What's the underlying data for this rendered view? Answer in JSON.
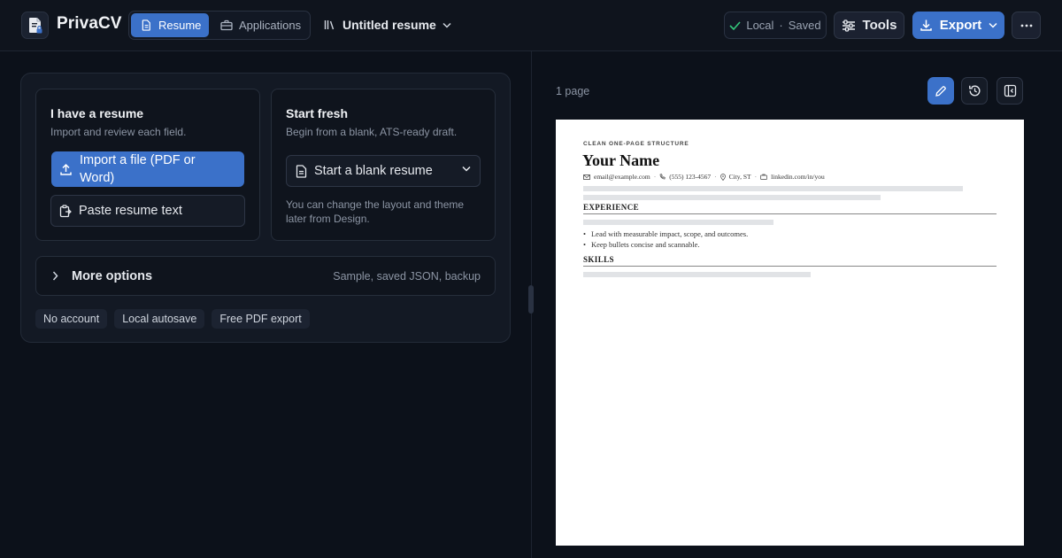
{
  "app": {
    "brand": "PrivaCV",
    "modes": [
      {
        "label": "Resume",
        "active": true
      },
      {
        "label": "Applications",
        "active": false
      }
    ],
    "resume_name": "Untitled resume"
  },
  "header": {
    "status_location": "Local",
    "status_separator": "·",
    "status_state": "Saved",
    "tools_label": "Tools",
    "export_label": "Export"
  },
  "start": {
    "have_resume": {
      "title": "I have a resume",
      "subtitle": "Import and review each field.",
      "import_label": "Import a file (PDF or Word)",
      "paste_label": "Paste resume text"
    },
    "fresh": {
      "title": "Start fresh",
      "subtitle": "Begin from a blank, ATS-ready draft.",
      "blank_label": "Start a blank resume",
      "note": "You can change the layout and theme later from Design."
    },
    "more_options": {
      "label": "More options",
      "hint": "Sample, saved JSON, backup"
    },
    "badges": [
      "No account",
      "Local autosave",
      "Free PDF export"
    ]
  },
  "preview": {
    "page_count": "1 page",
    "eyebrow": "CLEAN ONE-PAGE STRUCTURE",
    "name": "Your Name",
    "contact": {
      "email": "email@example.com",
      "phone": "(555) 123-4567",
      "location": "City, ST",
      "link": "linkedin.com/in/you"
    },
    "sections": [
      {
        "title": "EXPERIENCE",
        "bullets": [
          "Lead with measurable impact, scope, and outcomes.",
          "Keep bullets concise and scannable."
        ]
      },
      {
        "title": "SKILLS",
        "bullets": []
      }
    ]
  },
  "colors": {
    "accent": "#3b71c9",
    "background": "#0c111a",
    "panel": "#131924",
    "saved_check": "#34c77b"
  },
  "icons": {
    "logo": "document-lock-icon",
    "resume_tab": "document-icon",
    "applications_tab": "briefcase-icon",
    "resume_select": "library-icon",
    "saved": "check-icon",
    "tools": "sliders-icon",
    "export": "download-icon",
    "more": "more-horizontal-icon",
    "import": "upload-icon",
    "paste": "clipboard-icon",
    "blank": "file-text-icon",
    "edit": "pencil-icon",
    "history": "history-icon",
    "panel_toggle": "panel-left-icon"
  }
}
